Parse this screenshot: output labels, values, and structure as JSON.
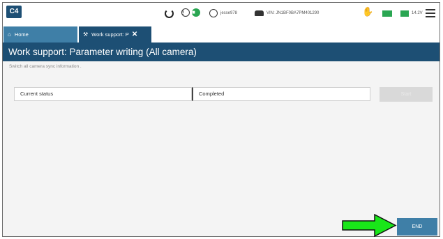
{
  "app": {
    "logo_text": "C4"
  },
  "topbar": {
    "user_label": "jesse978",
    "vin_label": "VIN: JN1BF0BA7PM401290",
    "voltage": "14.2V"
  },
  "tabs": [
    {
      "label": "Home",
      "icon": "home-icon",
      "active": false
    },
    {
      "label": "Work support: P",
      "icon": "wrench-icon",
      "active": true
    }
  ],
  "page": {
    "title": "Work support: Parameter writing (All camera)",
    "subtitle": "Switch all camera sync information ."
  },
  "status_row": {
    "label": "Current status",
    "value": "Completed",
    "start_label": "Start"
  },
  "footer": {
    "end_label": "END"
  },
  "colors": {
    "brand_dark": "#1d4f74",
    "brand_light": "#3f7fa7",
    "status_green": "#2aa652",
    "arrow_green": "#19e619"
  }
}
